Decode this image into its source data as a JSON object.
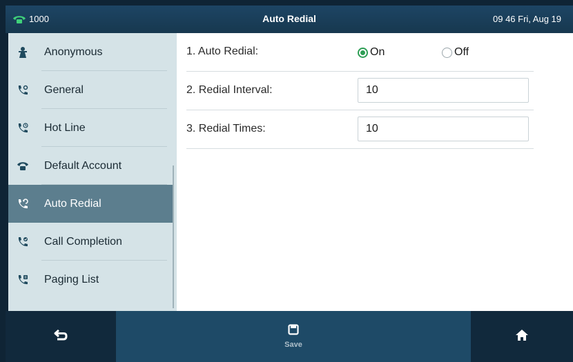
{
  "status_bar": {
    "account": "1000",
    "title": "Auto Redial",
    "datetime": "09 46 Fri, Aug 19"
  },
  "sidebar": {
    "items": [
      {
        "label": "Anonymous",
        "icon": "anonymous-icon"
      },
      {
        "label": "General",
        "icon": "call-icon"
      },
      {
        "label": "Hot Line",
        "icon": "hotline-icon"
      },
      {
        "label": "Default Account",
        "icon": "phone-icon"
      },
      {
        "label": "Auto Redial",
        "icon": "redial-icon",
        "active": true
      },
      {
        "label": "Call Completion",
        "icon": "call-completion-icon"
      },
      {
        "label": "Paging List",
        "icon": "paging-icon"
      }
    ]
  },
  "form": {
    "auto_redial": {
      "label": "1. Auto Redial:",
      "on_label": "On",
      "off_label": "Off",
      "selected": "On"
    },
    "redial_interval": {
      "label": "2. Redial Interval:",
      "value": "10"
    },
    "redial_times": {
      "label": "3. Redial Times:",
      "value": "10"
    }
  },
  "softkeys": {
    "back_icon": "back-arrow-icon",
    "save_label": "Save",
    "save_icon": "save-icon",
    "home_icon": "home-icon"
  },
  "colors": {
    "accent_green": "#2e9e55",
    "active_item": "#5c7e8e",
    "sidebar_bg": "#d5e3e7",
    "bar_bg": "#11293c"
  }
}
